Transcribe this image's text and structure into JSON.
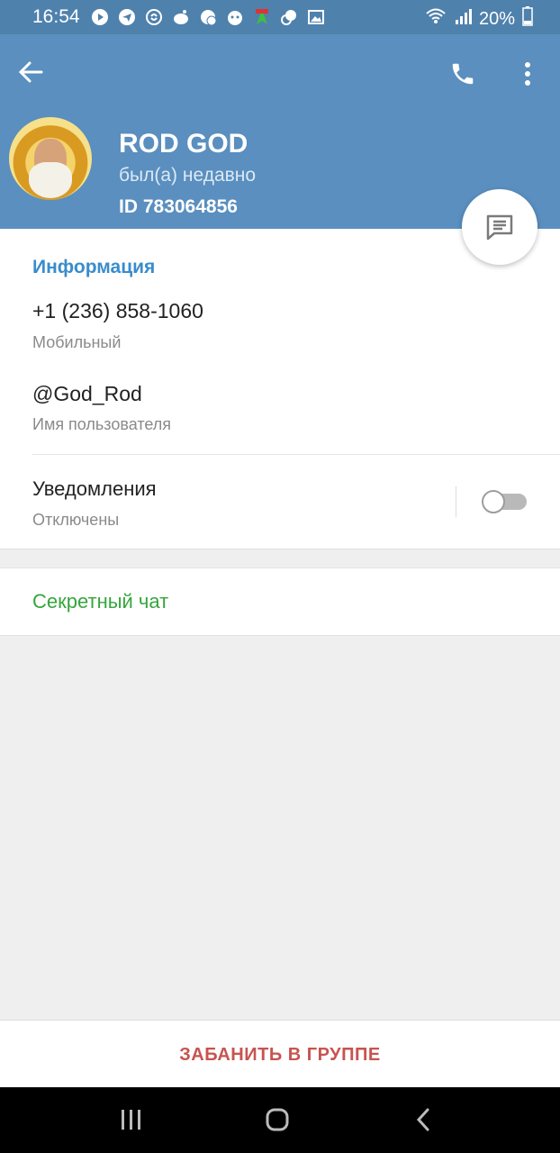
{
  "status_bar": {
    "time": "16:54",
    "battery": "20%",
    "notification_icons": [
      "youtube-icon",
      "telegram-icon",
      "shazam-icon",
      "reddit-icon",
      "vk-icon",
      "bot-icon",
      "fake-gps-icon",
      "translate-icon",
      "gallery-icon"
    ]
  },
  "profile": {
    "name": "ROD GOD",
    "status": "был(а) недавно",
    "id": "ID 783064856"
  },
  "info": {
    "title": "Информация",
    "phone": "+1 (236) 858-1060",
    "phone_label": "Мобильный",
    "username": "@God_Rod",
    "username_label": "Имя пользователя",
    "notifications": "Уведомления",
    "notifications_state": "Отключены",
    "notifications_enabled": false
  },
  "secret_chat": {
    "label": "Секретный чат"
  },
  "ban": {
    "label": "ЗАБАНИТЬ В ГРУППЕ"
  },
  "colors": {
    "header": "#5a8fbf",
    "statusbar": "#4f81ad",
    "section_title": "#3a8ccb",
    "secret_chat": "#35a63d",
    "ban": "#c75450"
  }
}
